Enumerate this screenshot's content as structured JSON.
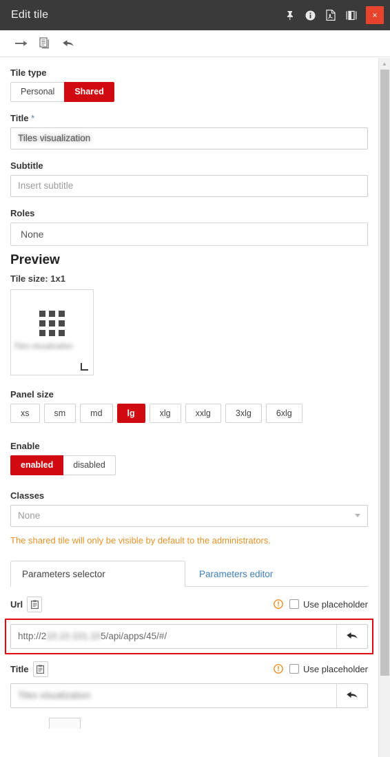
{
  "window": {
    "title": "Edit tile",
    "actions": [
      {
        "name": "pin-icon",
        "label": "Pin"
      },
      {
        "name": "info-icon",
        "label": "Info"
      },
      {
        "name": "export-pdf-icon",
        "label": "Export PDF"
      },
      {
        "name": "toggle-panel-icon",
        "label": "Toggle panel"
      }
    ],
    "close_label": "×"
  },
  "toolbar": {
    "items": [
      {
        "name": "go-forward-icon",
        "label": "Go"
      },
      {
        "name": "duplicate-icon",
        "label": "Duplicate"
      },
      {
        "name": "undo-icon",
        "label": "Undo"
      }
    ]
  },
  "form": {
    "tile_type": {
      "label": "Tile type",
      "options": [
        "Personal",
        "Shared"
      ],
      "selected": "Shared"
    },
    "title": {
      "label": "Title",
      "required_marker": "*",
      "value": "Tiles visualization",
      "redacted": true
    },
    "subtitle": {
      "label": "Subtitle",
      "placeholder": "Insert subtitle",
      "value": ""
    },
    "roles": {
      "label": "Roles",
      "value": "None"
    },
    "preview": {
      "heading": "Preview",
      "tile_size_label": "Tile size: 1x1",
      "tile_caption": "Tiles visualization",
      "icon": "grid-3x3-icon",
      "resize_handle": "resize-handle-icon"
    },
    "panel_size": {
      "label": "Panel size",
      "options": [
        "xs",
        "sm",
        "md",
        "lg",
        "xlg",
        "xxlg",
        "3xlg",
        "6xlg"
      ],
      "selected": "lg"
    },
    "enable": {
      "label": "Enable",
      "options": [
        "enabled",
        "disabled"
      ],
      "selected": "enabled"
    },
    "classes": {
      "label": "Classes",
      "value": "None"
    },
    "shared_warning": "The shared tile will only be visible by default to the administrators."
  },
  "tabs": {
    "items": [
      {
        "label": "Parameters selector",
        "active": true
      },
      {
        "label": "Parameters editor",
        "active": false
      }
    ]
  },
  "parameters": {
    "url": {
      "label": "Url",
      "clipboard_icon": "clipboard-icon",
      "warning_icon": "warning-circle-icon",
      "placeholder_checkbox_label": "Use placeholder",
      "placeholder_checked": false,
      "value_prefix": "http://2",
      "value_redacted": "10.10.101.10",
      "value_suffix": "5/api/apps/45/#/",
      "revert_icon": "revert-arrow-icon",
      "highlighted": true
    },
    "title": {
      "label": "Title",
      "clipboard_icon": "clipboard-icon",
      "warning_icon": "warning-circle-icon",
      "placeholder_checkbox_label": "Use placeholder",
      "placeholder_checked": false,
      "value": "Tiles visualization",
      "redacted": true,
      "revert_icon": "revert-arrow-icon"
    }
  },
  "scrollbar": {
    "up_arrow": "▲"
  },
  "colors": {
    "accent_red": "#d10a11",
    "close_red": "#e8432c",
    "highlight_red": "#e30613",
    "warning_orange": "#e8922a",
    "link_blue": "#3f7fb5",
    "titlebar_dark": "#3a3a3a"
  }
}
